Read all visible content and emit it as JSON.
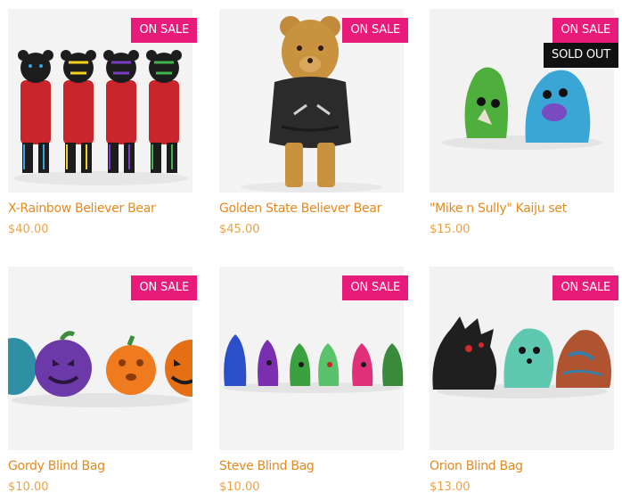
{
  "products": [
    {
      "name": "X-Rainbow Believer Bear",
      "price": "$40.00",
      "badges": [
        "ON SALE"
      ],
      "image": "four-painted-bear-figures"
    },
    {
      "name": "Golden State Believer Bear",
      "price": "$45.00",
      "badges": [
        "ON SALE"
      ],
      "image": "golden-bear-figure-in-hoodie"
    },
    {
      "name": "\"Mike n Sully\" Kaiju set",
      "price": "$15.00",
      "badges": [
        "ON SALE",
        "SOLD OUT"
      ],
      "image": "green-and-blue-kaiju-figures"
    },
    {
      "name": "Gordy Blind Bag",
      "price": "$10.00",
      "badges": [
        "ON SALE"
      ],
      "image": "painted-pumpkin-figures"
    },
    {
      "name": "Steve Blind Bag",
      "price": "$10.00",
      "badges": [
        "ON SALE"
      ],
      "image": "small-hooded-figures-row"
    },
    {
      "name": "Orion Blind Bag",
      "price": "$13.00",
      "badges": [
        "ON SALE"
      ],
      "image": "three-kaiju-figures"
    }
  ],
  "colors": {
    "title": "#e7891e",
    "price": "#e9a348",
    "sale_badge": "#e81b7a",
    "sold_out_badge": "#111111"
  }
}
